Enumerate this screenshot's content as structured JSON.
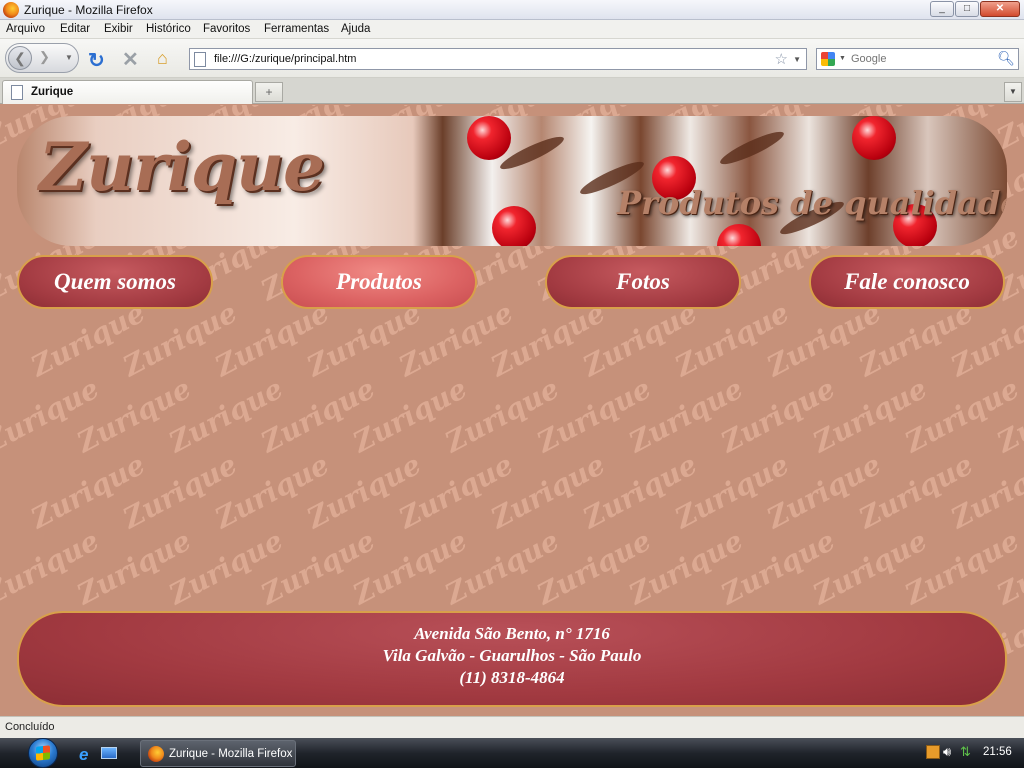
{
  "window": {
    "title": "Zurique - Mozilla Firefox",
    "controls": {
      "minimize": "_",
      "maximize": "□",
      "close": "✕"
    }
  },
  "menu": [
    "Arquivo",
    "Editar",
    "Exibir",
    "Histórico",
    "Favoritos",
    "Ferramentas",
    "Ajuda"
  ],
  "toolbar": {
    "url": "file:///G:/zurique/principal.htm",
    "search_placeholder": "Google"
  },
  "tabs": [
    {
      "label": "Zurique"
    }
  ],
  "page": {
    "logo_text": "Zurique",
    "slogan": "Produtos de qualidade",
    "watermark_text": "Zurique",
    "nav": [
      "Quem somos",
      "Produtos",
      "Fotos",
      "Fale conosco"
    ],
    "active_nav": "Produtos",
    "footer": {
      "line1": "Avenida São Bento, n° 1716",
      "line2": "Vila Galvão - Guarulhos - São Paulo",
      "line3": "(11) 8318-4864"
    },
    "colors": {
      "background": "#c6917a",
      "button": "#a23a41",
      "button_active": "#dc6363",
      "button_border": "#d8a04a"
    }
  },
  "status": {
    "text": "Concluído"
  },
  "taskbar": {
    "item_label": "Zurique - Mozilla Firefox",
    "clock": "21:56"
  }
}
